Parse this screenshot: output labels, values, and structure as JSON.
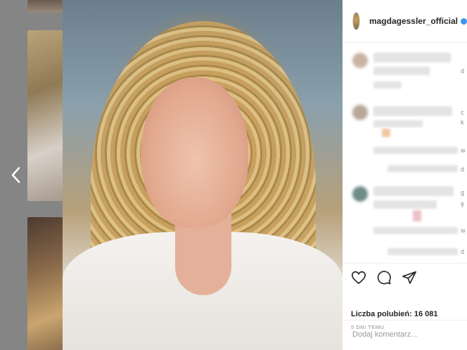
{
  "post": {
    "username": "magdagessler_official",
    "likes_label": "Liczba polubień:",
    "likes_count": "16 081",
    "date": "5 DNI TEMU",
    "comment_placeholder": "Dodaj komentarz...",
    "comment_initials": [
      "d",
      "c",
      "k",
      "w",
      "d",
      "g",
      "ę",
      "w",
      "d"
    ]
  },
  "icons": {
    "prev": "chevron-left-icon",
    "like": "heart-icon",
    "comment": "comment-icon",
    "share": "share-icon",
    "verified": "verified-badge-icon"
  },
  "colors": {
    "accent": "#3897f0",
    "text": "#262626",
    "muted": "#8e8e8e"
  }
}
